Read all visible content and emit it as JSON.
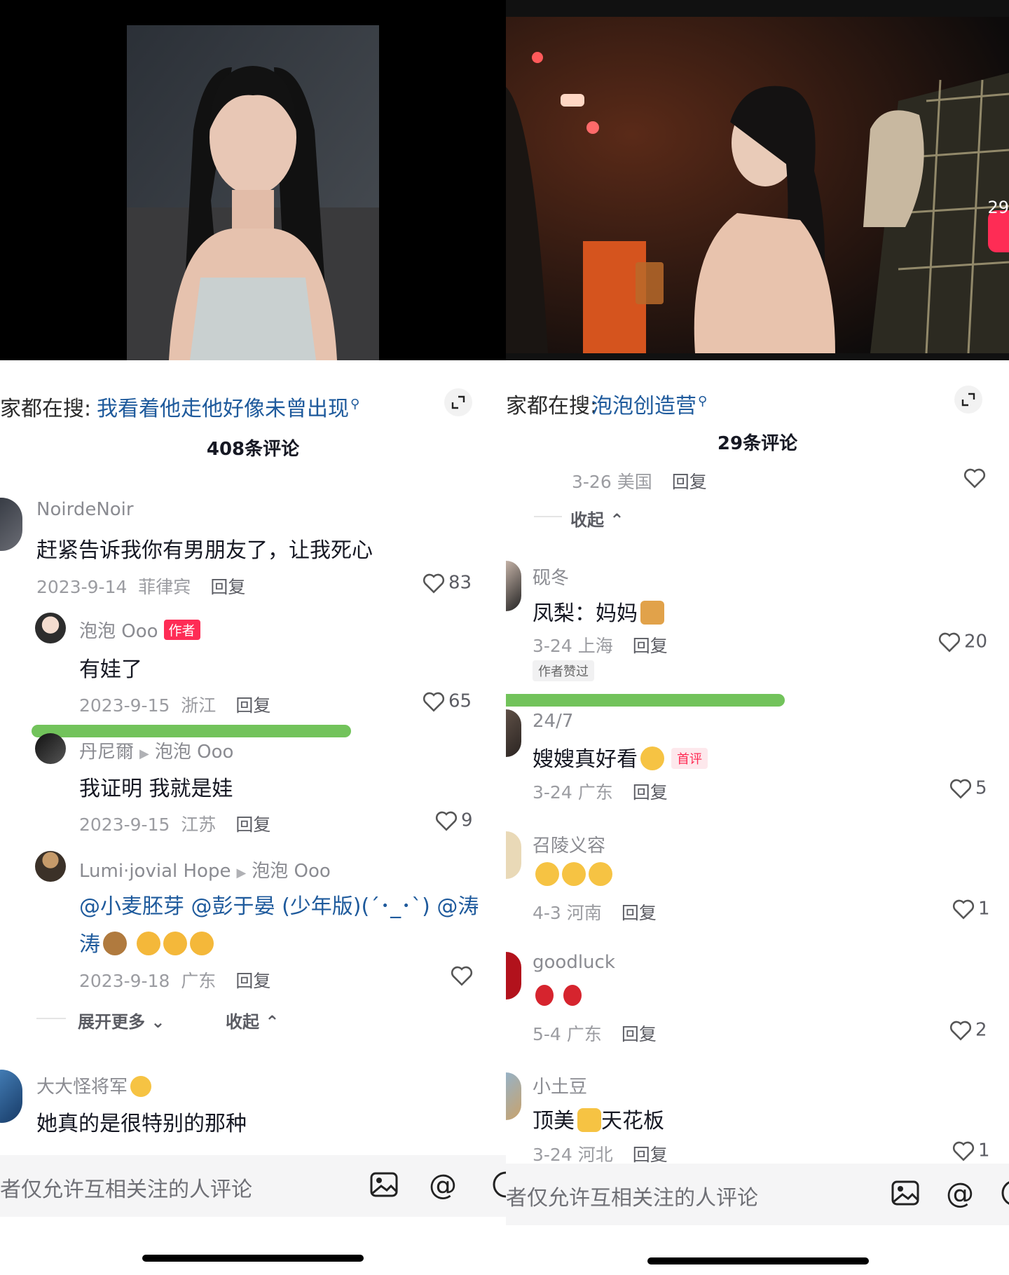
{
  "left": {
    "search": {
      "prefix": "家都在搜:",
      "term": "我看着他走他好像未曾出现"
    },
    "comment_count": "408条评论",
    "comments": [
      {
        "user": "NoirdeNoir",
        "text": "赶紧告诉我你有男朋友了，让我死心",
        "date": "2023-9-14",
        "loc": "菲律宾",
        "reply": "回复",
        "likes": "83"
      },
      {
        "user": "泡泡 Ooo",
        "tag": "作者",
        "text": "有娃了",
        "date": "2023-9-15",
        "loc": "浙江",
        "reply": "回复",
        "likes": "65"
      },
      {
        "user": "丹尼爾",
        "to": "泡泡 Ooo",
        "text": "我证明 我就是娃",
        "date": "2023-9-15",
        "loc": "江苏",
        "reply": "回复",
        "likes": "9"
      },
      {
        "user": "Lumi·jovial Hope",
        "to": "泡泡 Ooo",
        "text_line1": "@小麦胚芽 @彭于晏 (少年版)(´･_･`) @涛",
        "text_line2": "涛",
        "date": "2023-9-18",
        "loc": "广东",
        "reply": "回复",
        "likes": ""
      },
      {
        "user": "大大怪将军",
        "text": "她真的是很特别的那种"
      }
    ],
    "expand_more": "展开更多",
    "collapse": "收起",
    "bottom_placeholder": "者仅允许互相关注的人评论"
  },
  "right": {
    "search": {
      "prefix": "家都在搜:",
      "term": "泡泡创造营"
    },
    "comment_count": "29条评论",
    "top_meta": {
      "date": "3-26",
      "loc": "美国",
      "reply": "回复"
    },
    "collapse": "收起",
    "comments": [
      {
        "user": "砚冬",
        "text": "凤梨：妈妈",
        "date": "3-24",
        "loc": "上海",
        "reply": "回复",
        "likes": "20",
        "liked_by_author": "作者赞过"
      },
      {
        "user": "24/7",
        "text": "嫂嫂真好看",
        "tag": "首评",
        "date": "3-24",
        "loc": "广东",
        "reply": "回复",
        "likes": "5"
      },
      {
        "user": "召陵义容",
        "text": "",
        "date": "4-3",
        "loc": "河南",
        "reply": "回复",
        "likes": "1"
      },
      {
        "user": "goodluck",
        "text": "",
        "date": "5-4",
        "loc": "广东",
        "reply": "回复",
        "likes": "2"
      },
      {
        "user": "小土豆",
        "text_a": "顶美",
        "text_b": "天花板",
        "date": "3-24",
        "loc": "河北",
        "reply": "回复",
        "likes": "1"
      }
    ],
    "side_count": "29",
    "bottom_placeholder": "者仅允许互相关注的人评论"
  },
  "colors": {
    "link": "#1e5a9c",
    "accent": "#fe2c55",
    "highlight": "#72c35b"
  },
  "icons": [
    "expand-icon",
    "search-mini-icon",
    "heart-icon",
    "image-icon",
    "at-icon",
    "emoji-icon",
    "chevron-down-icon",
    "chevron-up-icon"
  ]
}
